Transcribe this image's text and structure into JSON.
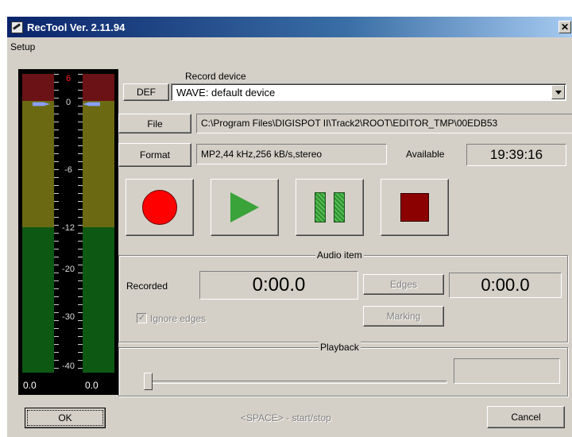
{
  "window": {
    "title": "RecTool Ver. 2.11.94",
    "close_glyph": "✕"
  },
  "menu": {
    "items": [
      "Setup"
    ]
  },
  "vu_meter": {
    "scale": [
      "6",
      "0",
      "-6",
      "-12",
      "-20",
      "-30",
      "-40"
    ],
    "left_value": "0.0",
    "right_value": "0.0"
  },
  "record_device": {
    "label": "Record device",
    "def_button": "DEF",
    "selected": "WAVE: default device"
  },
  "file": {
    "button": "File",
    "path": "C:\\Program Files\\DIGISPOT II\\Track2\\ROOT\\EDITOR_TMP\\00EDB53"
  },
  "format": {
    "button": "Format",
    "value": "MP2,44 kHz,256 kB/s,stereo"
  },
  "available": {
    "label": "Available",
    "value": "19:39:16"
  },
  "transport": {
    "record_icon": "record-icon",
    "play_icon": "play-icon",
    "pause_icon": "pause-icon",
    "stop_icon": "stop-icon"
  },
  "audio_item": {
    "title": "Audio item",
    "recorded_label": "Recorded",
    "recorded_value": "0:00.0",
    "edges_button": "Edges",
    "edges_value": "0:00.0",
    "ignore_edges_label": "Ignore edges",
    "ignore_edges_mark": "✓",
    "marking_button": "Marking"
  },
  "playback": {
    "title": "Playback",
    "value": ""
  },
  "footer": {
    "ok": "OK",
    "hint": "<SPACE> - start/stop",
    "cancel": "Cancel"
  },
  "colors": {
    "title_bar": "#0a246a",
    "record": "#ff0000",
    "play": "#3aa33a",
    "stop": "#8b0000"
  }
}
